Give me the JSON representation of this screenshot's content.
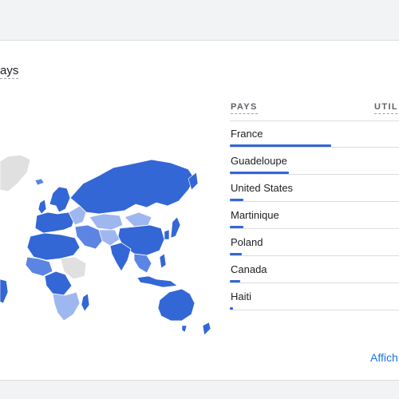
{
  "card": {
    "title": "ays",
    "view_link": "Affich"
  },
  "table": {
    "header_country": "PAYS",
    "header_users": "UTIL",
    "rows": [
      {
        "name": "France",
        "share": 0.6
      },
      {
        "name": "Guadeloupe",
        "share": 0.35
      },
      {
        "name": "United States",
        "share": 0.08
      },
      {
        "name": "Martinique",
        "share": 0.08
      },
      {
        "name": "Poland",
        "share": 0.07
      },
      {
        "name": "Canada",
        "share": 0.06
      },
      {
        "name": "Haiti",
        "share": 0.02
      }
    ]
  },
  "colors": {
    "bar": "#3367d6",
    "map_strong": "#3367d6",
    "map_medium": "#5c85e3",
    "map_light": "#9fb7f0",
    "map_none": "#e0e0e0"
  }
}
